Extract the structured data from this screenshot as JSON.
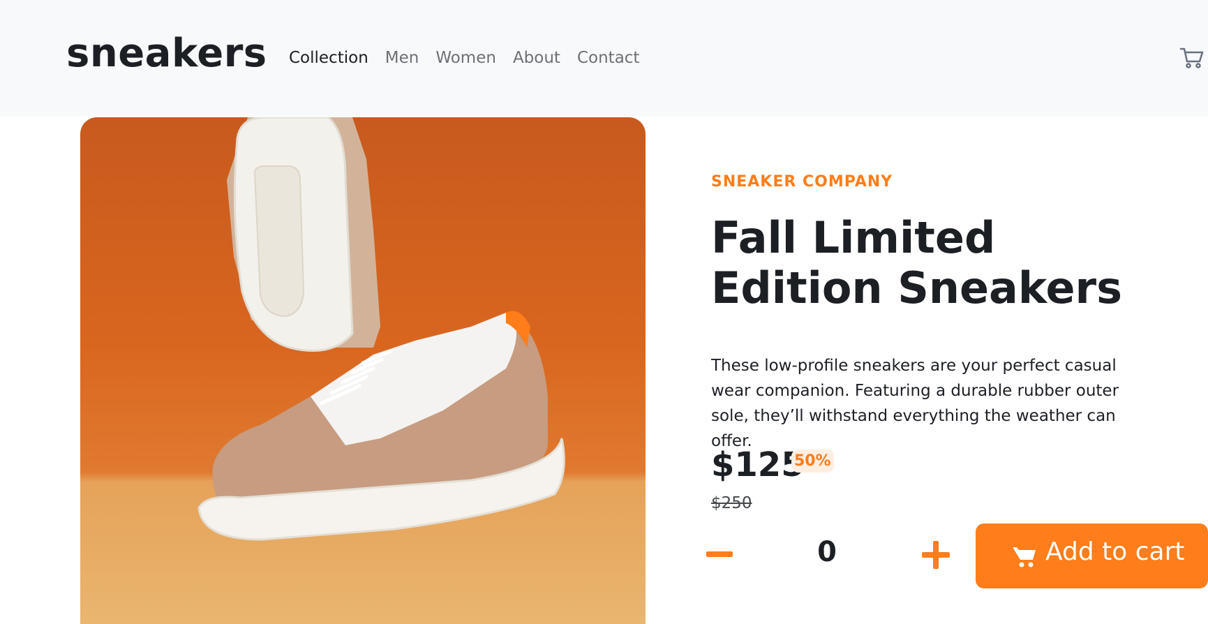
{
  "header": {
    "logo": "sneakers",
    "nav": [
      {
        "label": "Collection",
        "active": true
      },
      {
        "label": "Men",
        "active": false
      },
      {
        "label": "Women",
        "active": false
      },
      {
        "label": "About",
        "active": false
      },
      {
        "label": "Contact",
        "active": false
      }
    ],
    "cart_icon": "cart-icon"
  },
  "product": {
    "company": "SNEAKER COMPANY",
    "title": "Fall Limited Edition Sneakers",
    "description": "These low-profile sneakers are your perfect casual wear companion. Featuring a durable rubber outer sole, they’ll withstand everything the weather can offer.",
    "price": "$125",
    "discount": "50%",
    "original_price": "$250",
    "quantity": "0",
    "add_to_cart_label": "Add to cart",
    "image_icon": "product-photo"
  },
  "colors": {
    "accent": "#ff7d1a",
    "accent_light": "#ffeee2",
    "text_dark": "#1c1f24",
    "text_muted": "#6c7177",
    "header_bg": "#f8f9fa"
  }
}
